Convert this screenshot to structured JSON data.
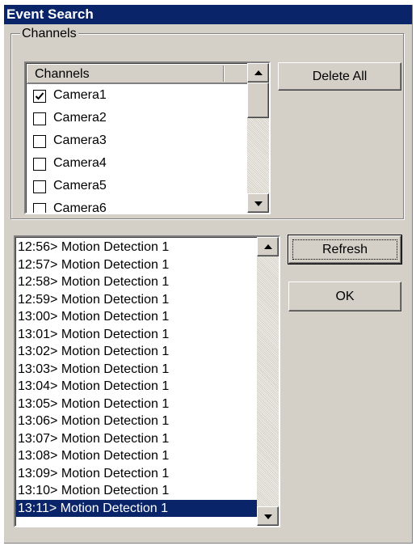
{
  "window": {
    "title": "Event Search"
  },
  "channels_group": {
    "label": "Channels",
    "header": "Channels",
    "items": [
      {
        "label": "Camera1",
        "checked": true
      },
      {
        "label": "Camera2",
        "checked": false
      },
      {
        "label": "Camera3",
        "checked": false
      },
      {
        "label": "Camera4",
        "checked": false
      },
      {
        "label": "Camera5",
        "checked": false
      },
      {
        "label": "Camera6",
        "checked": false
      }
    ]
  },
  "buttons": {
    "delete_all": "Delete All",
    "refresh": "Refresh",
    "ok": "OK"
  },
  "events": [
    "12:56> Motion Detection 1",
    "12:57> Motion Detection 1",
    "12:58> Motion Detection 1",
    "12:59> Motion Detection 1",
    "13:00> Motion Detection 1",
    "13:01> Motion Detection 1",
    "13:02> Motion Detection 1",
    "13:03> Motion Detection 1",
    "13:04> Motion Detection 1",
    "13:05> Motion Detection 1",
    "13:06> Motion Detection 1",
    "13:07> Motion Detection 1",
    "13:08> Motion Detection 1",
    "13:09> Motion Detection 1",
    "13:10> Motion Detection 1",
    "13:11> Motion Detection 1"
  ],
  "selected_event_index": 15,
  "colors": {
    "selection": "#0a246a",
    "face": "#d4d0c8"
  }
}
